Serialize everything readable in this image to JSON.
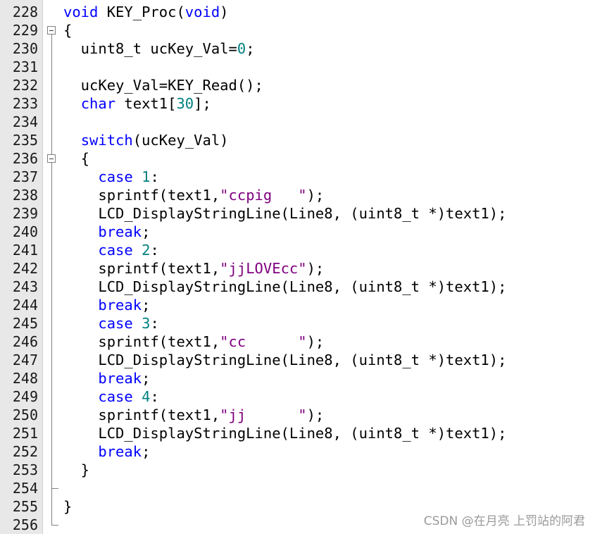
{
  "editor": {
    "lines": [
      {
        "num": "228",
        "tokens": [
          {
            "t": "void",
            "c": "kw"
          },
          {
            "t": " KEY_Proc("
          },
          {
            "t": "void",
            "c": "kw"
          },
          {
            "t": ")"
          }
        ]
      },
      {
        "num": "229",
        "tokens": [
          {
            "t": "{"
          }
        ]
      },
      {
        "num": "230",
        "tokens": [
          {
            "t": "  uint8_t ucKey_Val="
          },
          {
            "t": "0",
            "c": "num"
          },
          {
            "t": ";"
          }
        ]
      },
      {
        "num": "231",
        "tokens": []
      },
      {
        "num": "232",
        "tokens": [
          {
            "t": "  ucKey_Val=KEY_Read();"
          }
        ]
      },
      {
        "num": "233",
        "tokens": [
          {
            "t": "  "
          },
          {
            "t": "char",
            "c": "kw"
          },
          {
            "t": " text1["
          },
          {
            "t": "30",
            "c": "num"
          },
          {
            "t": "];"
          }
        ]
      },
      {
        "num": "234",
        "tokens": []
      },
      {
        "num": "235",
        "tokens": [
          {
            "t": "  "
          },
          {
            "t": "switch",
            "c": "kw"
          },
          {
            "t": "(ucKey_Val)"
          }
        ]
      },
      {
        "num": "236",
        "tokens": [
          {
            "t": "  {"
          }
        ]
      },
      {
        "num": "237",
        "tokens": [
          {
            "t": "    "
          },
          {
            "t": "case",
            "c": "kw"
          },
          {
            "t": " "
          },
          {
            "t": "1",
            "c": "num"
          },
          {
            "t": ":"
          }
        ]
      },
      {
        "num": "238",
        "tokens": [
          {
            "t": "    sprintf(text1,"
          },
          {
            "t": "\"ccpig   \"",
            "c": "str"
          },
          {
            "t": ");"
          }
        ]
      },
      {
        "num": "239",
        "tokens": [
          {
            "t": "    LCD_DisplayStringLine(Line8, (uint8_t *)text1);"
          }
        ]
      },
      {
        "num": "240",
        "tokens": [
          {
            "t": "    "
          },
          {
            "t": "break",
            "c": "kw"
          },
          {
            "t": ";"
          }
        ]
      },
      {
        "num": "241",
        "tokens": [
          {
            "t": "    "
          },
          {
            "t": "case",
            "c": "kw"
          },
          {
            "t": " "
          },
          {
            "t": "2",
            "c": "num"
          },
          {
            "t": ":"
          }
        ]
      },
      {
        "num": "242",
        "tokens": [
          {
            "t": "    sprintf(text1,"
          },
          {
            "t": "\"jjLOVEcc\"",
            "c": "str"
          },
          {
            "t": ");"
          }
        ]
      },
      {
        "num": "243",
        "tokens": [
          {
            "t": "    LCD_DisplayStringLine(Line8, (uint8_t *)text1);"
          }
        ]
      },
      {
        "num": "244",
        "tokens": [
          {
            "t": "    "
          },
          {
            "t": "break",
            "c": "kw"
          },
          {
            "t": ";"
          }
        ]
      },
      {
        "num": "245",
        "tokens": [
          {
            "t": "    "
          },
          {
            "t": "case",
            "c": "kw"
          },
          {
            "t": " "
          },
          {
            "t": "3",
            "c": "num"
          },
          {
            "t": ":"
          }
        ]
      },
      {
        "num": "246",
        "tokens": [
          {
            "t": "    sprintf(text1,"
          },
          {
            "t": "\"cc      \"",
            "c": "str"
          },
          {
            "t": ");"
          }
        ]
      },
      {
        "num": "247",
        "tokens": [
          {
            "t": "    LCD_DisplayStringLine(Line8, (uint8_t *)text1);"
          }
        ]
      },
      {
        "num": "248",
        "tokens": [
          {
            "t": "    "
          },
          {
            "t": "break",
            "c": "kw"
          },
          {
            "t": ";"
          }
        ]
      },
      {
        "num": "249",
        "tokens": [
          {
            "t": "    "
          },
          {
            "t": "case",
            "c": "kw"
          },
          {
            "t": " "
          },
          {
            "t": "4",
            "c": "num"
          },
          {
            "t": ":"
          }
        ]
      },
      {
        "num": "250",
        "tokens": [
          {
            "t": "    sprintf(text1,"
          },
          {
            "t": "\"jj      \"",
            "c": "str"
          },
          {
            "t": ");"
          }
        ]
      },
      {
        "num": "251",
        "tokens": [
          {
            "t": "    LCD_DisplayStringLine(Line8, (uint8_t *)text1);"
          }
        ]
      },
      {
        "num": "252",
        "tokens": [
          {
            "t": "    "
          },
          {
            "t": "break",
            "c": "kw"
          },
          {
            "t": ";"
          }
        ]
      },
      {
        "num": "253",
        "tokens": [
          {
            "t": "  }"
          }
        ]
      },
      {
        "num": "254",
        "tokens": []
      },
      {
        "num": "255",
        "tokens": [
          {
            "t": "}"
          }
        ]
      },
      {
        "num": "256",
        "tokens": []
      }
    ]
  },
  "colors": {
    "keyword": "#0000ff",
    "number": "#008080",
    "string": "#800080",
    "gutter_bg": "#e8e8e8"
  },
  "watermark": "CSDN @在月亮 上罚站的阿君"
}
